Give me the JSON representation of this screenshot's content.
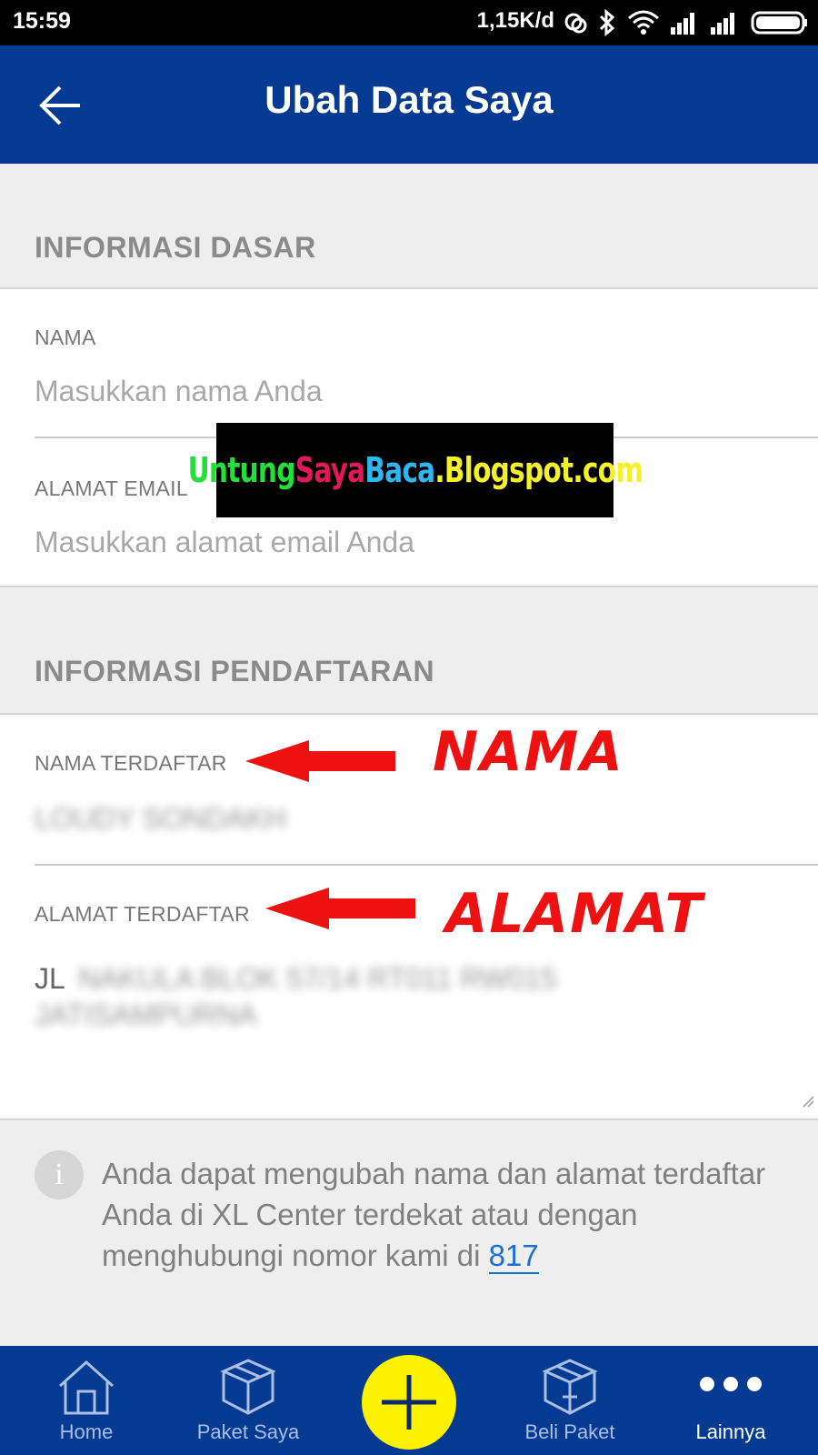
{
  "status_bar": {
    "time": "15:59",
    "network_speed": "1,15K/d"
  },
  "app_bar": {
    "title": "Ubah Data Saya",
    "back_icon": "arrow-left-icon"
  },
  "basic_info": {
    "header": "INFORMASI DASAR",
    "name_label": "NAMA",
    "name_placeholder": "Masukkan nama Anda",
    "email_label": "ALAMAT EMAIL",
    "email_placeholder": "Masukkan alamat email Anda"
  },
  "registration_info": {
    "header": "INFORMASI PENDAFTARAN",
    "registered_name_label": "NAMA TERDAFTAR",
    "registered_name_value": "LOUDY SONDAKH",
    "registered_address_label": "ALAMAT TERDAFTAR",
    "registered_address_prefix": "JL",
    "registered_address_blurred_1": "NAKULA BLOK 57/14 RT011 RW015",
    "registered_address_blurred_2": "JATISAMPURNA"
  },
  "watermark": {
    "parts": [
      {
        "text": "Untung",
        "color": "#22e038"
      },
      {
        "text": "Saya",
        "color": "#e0195a"
      },
      {
        "text": "Baca",
        "color": "#2fb6f0"
      },
      {
        "text": ".Blogspot.com",
        "color": "#f4f02a"
      }
    ]
  },
  "annotations": {
    "name": "NAMA",
    "address": "ALAMAT",
    "color": "#ee1111"
  },
  "info": {
    "icon": "info-icon",
    "text": "Anda dapat mengubah nama dan alamat terdaftar Anda di XL Center terdekat atau dengan menghubungi nomor kami di",
    "link": "817"
  },
  "bottom_nav": {
    "items": [
      {
        "label": "Home",
        "icon": "home-icon"
      },
      {
        "label": "Paket Saya",
        "icon": "package-icon"
      },
      {
        "label": "Beli Paket",
        "icon": "buy-package-icon"
      },
      {
        "label": "Lainnya",
        "icon": "more-icon"
      }
    ],
    "active": "Lainnya",
    "fab_icon": "plus-icon"
  },
  "colors": {
    "primary": "#053a92",
    "fab": "#fff200",
    "link": "#1a6fd6"
  }
}
